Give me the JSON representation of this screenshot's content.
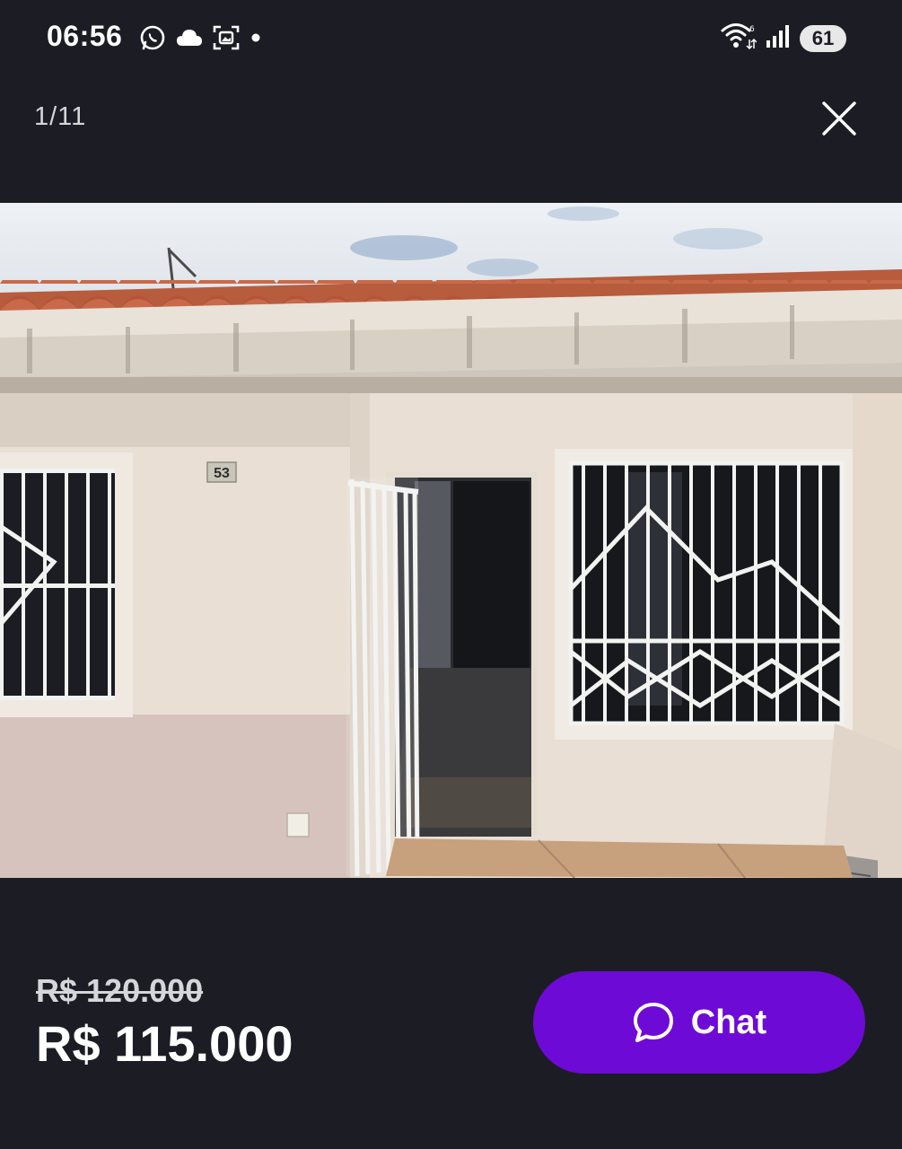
{
  "status_bar": {
    "time": "06:56",
    "battery_level": "61",
    "left_icons": [
      "whatsapp-icon",
      "cloud-icon",
      "screenshot-icon",
      "dot-icon"
    ],
    "right_icons": [
      "wifi-icon",
      "signal-icon",
      "battery-icon"
    ]
  },
  "viewer": {
    "counter": "1/11",
    "close_icon": "close-icon"
  },
  "photo": {
    "house_number": "53"
  },
  "listing": {
    "old_price": "R$ 120.000",
    "price": "R$ 115.000"
  },
  "chat_button": {
    "label": "Chat",
    "icon": "chat-bubble-icon",
    "color": "#6e0ad6"
  },
  "colors": {
    "background": "#1c1d24",
    "accent": "#6e0ad6"
  }
}
